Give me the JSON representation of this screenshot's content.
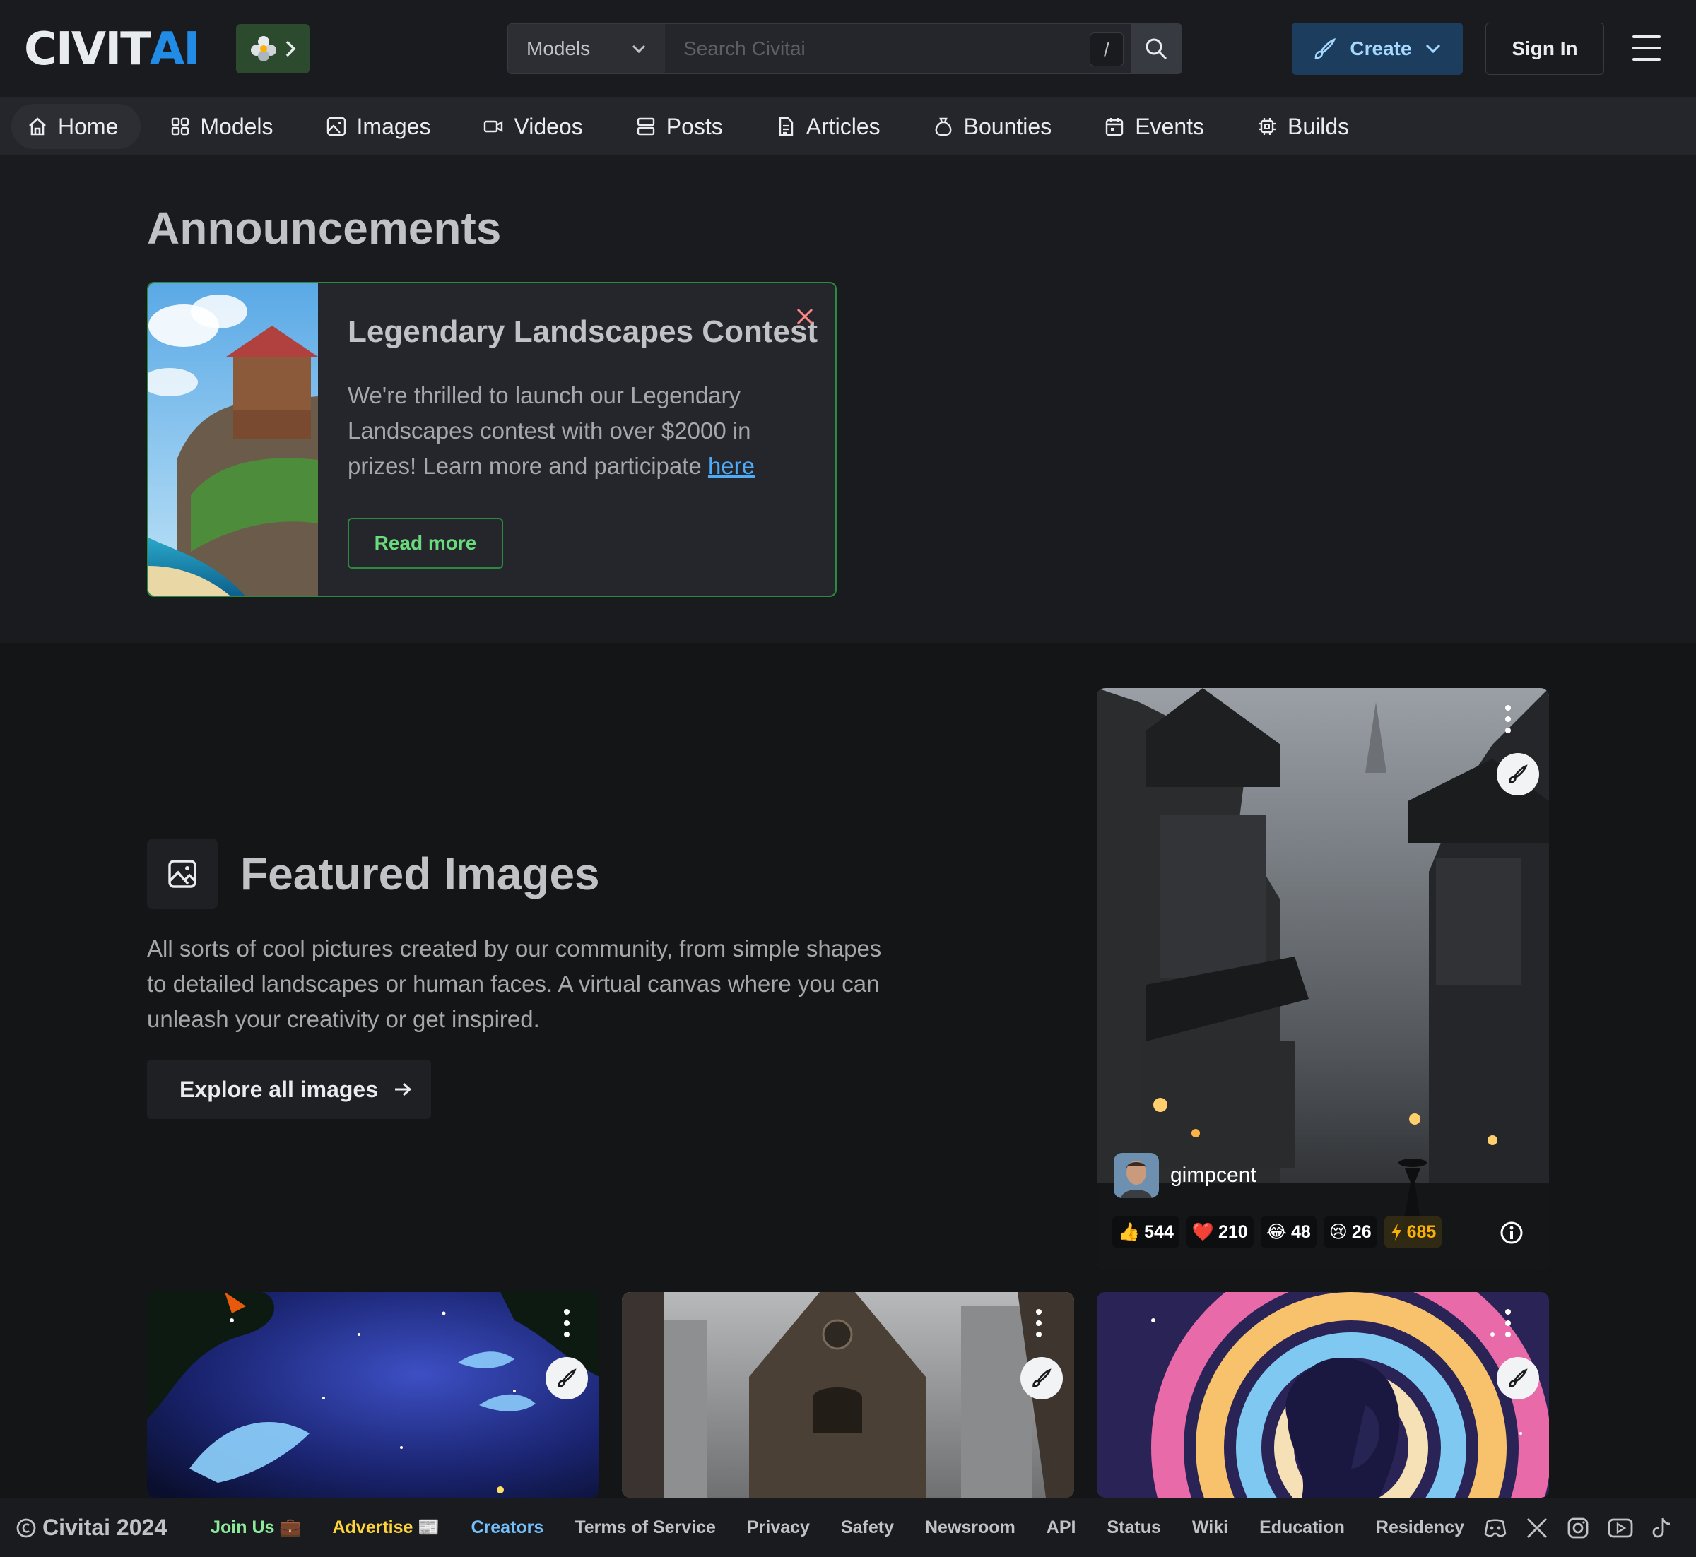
{
  "header": {
    "logo_text_a": "CIVIT",
    "logo_text_b": "AI",
    "search": {
      "category": "Models",
      "placeholder": "Search Civitai",
      "shortcut": "/"
    },
    "create_label": "Create",
    "signin_label": "Sign In"
  },
  "nav": {
    "items": [
      {
        "label": "Home",
        "icon": "home-icon"
      },
      {
        "label": "Models",
        "icon": "grid-icon"
      },
      {
        "label": "Images",
        "icon": "photo-icon"
      },
      {
        "label": "Videos",
        "icon": "video-icon"
      },
      {
        "label": "Posts",
        "icon": "layout-list-icon"
      },
      {
        "label": "Articles",
        "icon": "file-text-icon"
      },
      {
        "label": "Bounties",
        "icon": "moneybag-icon"
      },
      {
        "label": "Events",
        "icon": "calendar-icon"
      },
      {
        "label": "Builds",
        "icon": "cpu-icon"
      }
    ]
  },
  "announcements": {
    "title": "Announcements",
    "card": {
      "heading": "Legendary Landscapes Contest",
      "body": "We're thrilled to launch our Legendary Landscapes contest with over $2000 in prizes! Learn more and participate ",
      "link_text": "here",
      "button": "Read more"
    }
  },
  "featured": {
    "title": "Featured Images",
    "description": "All sorts of cool pictures created by our community, from simple shapes to detailed landscapes or human faces. A virtual canvas where you can unleash your creativity or get inspired.",
    "explore_label": "Explore all images",
    "main_card": {
      "username": "gimpcent",
      "reactions": {
        "like": "544",
        "heart": "210",
        "laugh": "48",
        "cry": "26",
        "buzz": "685"
      }
    }
  },
  "footer": {
    "copyright": "Civitai 2024",
    "links": [
      "Join Us 💼",
      "Advertise 📰",
      "Creators",
      "Terms of Service",
      "Privacy",
      "Safety",
      "Newsroom",
      "API",
      "Status",
      "Wiki",
      "Education",
      "Residency"
    ]
  },
  "colors": {
    "accent": "#228be6",
    "announcement_border": "#2b8a3e",
    "buzz": "#fab005"
  }
}
